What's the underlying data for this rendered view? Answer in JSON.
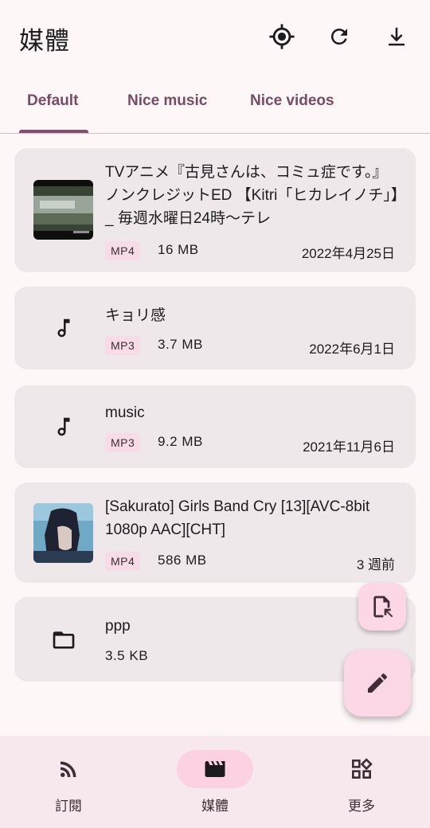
{
  "header": {
    "title": "媒體",
    "actions": [
      {
        "name": "locate-icon"
      },
      {
        "name": "refresh-icon"
      },
      {
        "name": "download-icon"
      }
    ]
  },
  "tabs": [
    {
      "label": "Default",
      "selected": true
    },
    {
      "label": "Nice music",
      "selected": false
    },
    {
      "label": "Nice videos",
      "selected": false
    }
  ],
  "items": [
    {
      "kind": "video",
      "title": "TVアニメ『古見さんは、コミュ症です。』ノンクレジットED 【Kitri「ヒカレイノチ」】_ 毎週水曜日24時～テレ",
      "format": "MP4",
      "size": "16 MB",
      "date": "2022年4月25日"
    },
    {
      "kind": "audio",
      "icon": "music-note-icon",
      "title": "キョリ感",
      "format": "MP3",
      "size": "3.7 MB",
      "date": "2022年6月1日"
    },
    {
      "kind": "audio",
      "icon": "music-note-icon",
      "title": "music",
      "format": "MP3",
      "size": "9.2 MB",
      "date": "2021年11月6日"
    },
    {
      "kind": "video",
      "title": "[Sakurato] Girls Band Cry [13][AVC-8bit 1080p AAC][CHT]",
      "format": "MP4",
      "size": "586 MB",
      "date": "3 週前"
    },
    {
      "kind": "folder",
      "icon": "folder-icon",
      "title": "ppp",
      "size": "3.5 KB"
    }
  ],
  "fabs": {
    "small_icon": "import-file-icon",
    "large_icon": "edit-icon"
  },
  "bottom_nav": [
    {
      "label": "訂閱",
      "icon": "rss-feed-icon",
      "selected": false
    },
    {
      "label": "媒體",
      "icon": "clapperboard-icon",
      "selected": true
    },
    {
      "label": "更多",
      "icon": "widgets-icon",
      "selected": false
    }
  ],
  "colors": {
    "background": "#fef7f8",
    "card": "#efe8ea",
    "accent": "#8b4a6b",
    "fab": "#fcd8e7",
    "nav_bar": "#f7e8ee"
  }
}
